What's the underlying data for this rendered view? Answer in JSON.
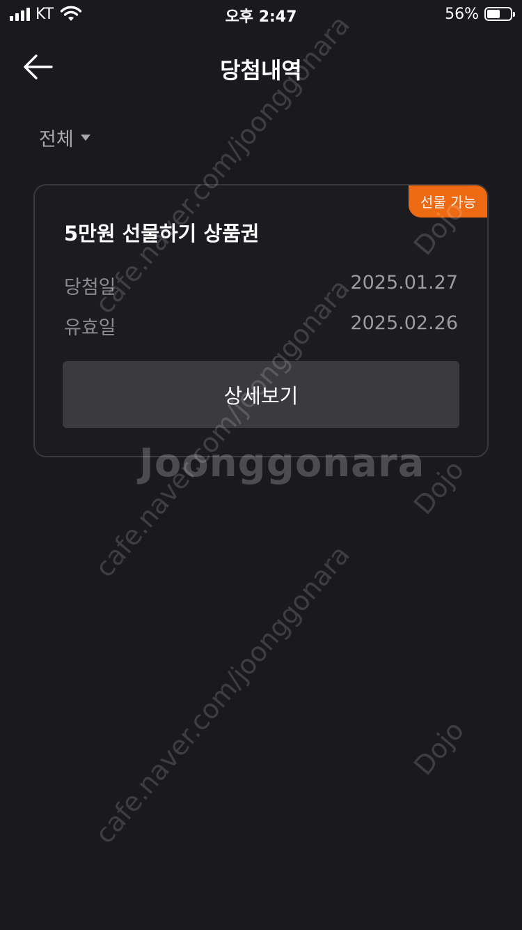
{
  "status_bar": {
    "carrier": "KT",
    "time": "오후 2:47",
    "battery_percent": "56%",
    "battery_level": 0.56
  },
  "header": {
    "back_icon": "arrow-left-icon",
    "title": "당첨내역"
  },
  "filter": {
    "label": "전체",
    "icon": "caret-down-icon"
  },
  "card": {
    "badge": "선물 가능",
    "title": "5만원 선물하기 상품권",
    "rows": [
      {
        "label": "당첨일",
        "value": "2025.01.27"
      },
      {
        "label": "유효일",
        "value": "2025.02.26"
      }
    ],
    "button_label": "상세보기"
  },
  "colors": {
    "background": "#1a191e",
    "card_border": "#3a393e",
    "badge": "#ee6a12",
    "button": "#3b3a3f"
  },
  "watermark": {
    "logo": "Joonggonara",
    "url": "cafe.naver.com/joonggonara",
    "tag": "Dojo"
  }
}
